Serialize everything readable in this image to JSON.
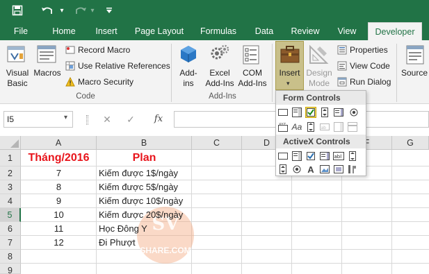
{
  "qat": {
    "save_icon": "save-icon",
    "undo_icon": "undo-icon",
    "redo_icon": "redo-icon",
    "customize_icon": "customize-qat-icon"
  },
  "tabs": [
    {
      "label": "File"
    },
    {
      "label": "Home"
    },
    {
      "label": "Insert"
    },
    {
      "label": "Page Layout"
    },
    {
      "label": "Formulas"
    },
    {
      "label": "Data"
    },
    {
      "label": "Review"
    },
    {
      "label": "View"
    },
    {
      "label": "Developer",
      "active": true
    }
  ],
  "ribbon": {
    "code": {
      "visual_basic": "Visual\nBasic",
      "macros": "Macros",
      "record_macro": "Record Macro",
      "relative_refs": "Use Relative References",
      "macro_security": "Macro Security",
      "label": "Code"
    },
    "addins": {
      "addins": "Add-\nins",
      "excel_addins": "Excel\nAdd-Ins",
      "com_addins": "COM\nAdd-Ins",
      "label": "Add-Ins"
    },
    "controls": {
      "insert": "Insert",
      "design_mode": "Design\nMode",
      "properties": "Properties",
      "view_code": "View Code",
      "run_dialog": "Run Dialog"
    },
    "xml": {
      "source": "Source"
    }
  },
  "formula_bar": {
    "name_box": "I5",
    "cancel": "✕",
    "enter": "✓",
    "fx": "fx",
    "formula": ""
  },
  "columns": [
    "A",
    "B",
    "C",
    "D",
    "E",
    "F",
    "G"
  ],
  "rows": [
    "1",
    "2",
    "3",
    "4",
    "5",
    "6",
    "7",
    "8",
    "9"
  ],
  "cells": {
    "A1": "Tháng/2016",
    "B1": "Plan",
    "A2": "7",
    "B2": "Kiếm được 1$/ngày",
    "A3": "8",
    "B3": "Kiếm được 5$/ngày",
    "A4": "9",
    "B4": "Kiếm được 10$/ngày",
    "A5": "10",
    "B5": "Kiếm được 20$/ngày",
    "A6": "11",
    "B6": "Học Đông Y",
    "A7": "12",
    "B7": "Đi Phượt"
  },
  "dropdown": {
    "form_controls": "Form Controls",
    "activex_controls": "ActiveX Controls"
  },
  "watermark": {
    "top": "SV",
    "bottom": "SHARE.COM"
  },
  "colors": {
    "accent": "#217346",
    "header_red": "#e8141b",
    "active_tab_bg": "#f3f3f3",
    "selected_ctl": "#f7e36a"
  }
}
